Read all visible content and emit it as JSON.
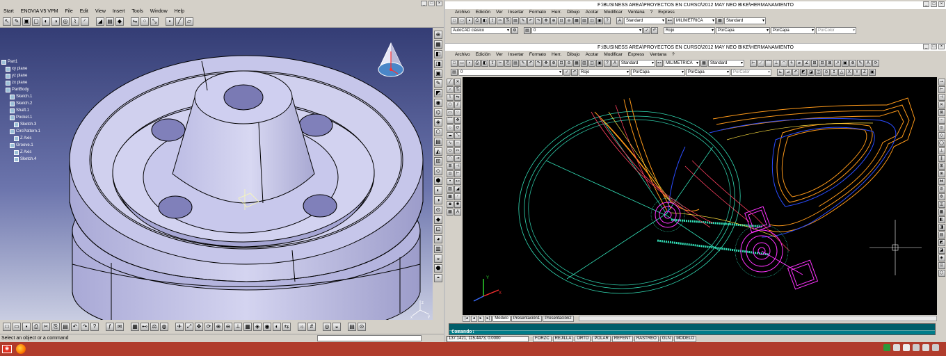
{
  "catia": {
    "menu": [
      "Start",
      "ENOVIA V5 VPM",
      "File",
      "Edit",
      "View",
      "Insert",
      "Tools",
      "Window",
      "Help"
    ],
    "tree": [
      {
        "label": "Part1",
        "level": 0
      },
      {
        "label": "xy plane",
        "level": 1
      },
      {
        "label": "yz plane",
        "level": 1
      },
      {
        "label": "zx plane",
        "level": 1
      },
      {
        "label": "PartBody",
        "level": 1
      },
      {
        "label": "Sketch.1",
        "level": 2
      },
      {
        "label": "Sketch.2",
        "level": 2
      },
      {
        "label": "Shaft.1",
        "level": 2
      },
      {
        "label": "Pocket.1",
        "level": 2
      },
      {
        "label": "Sketch.3",
        "level": 3
      },
      {
        "label": "CircPattern.1",
        "level": 2
      },
      {
        "label": "Z Axis",
        "level": 3
      },
      {
        "label": "Groove.1",
        "level": 2
      },
      {
        "label": "Z Axis",
        "level": 3
      },
      {
        "label": "Sketch.4",
        "level": 3
      }
    ],
    "status_text": "Select an object or a command",
    "compass_label": "",
    "axis_label_x": "x",
    "axis_label_y": "y",
    "axis_label_z": "z"
  },
  "autocad": {
    "outer_title": "F:\\BUSINESS AREA\\PROYECTOS EN CURSO\\2012 MAY NEO BIKE\\HERMANAMIENTO",
    "inner_title": "F:\\BUSINESS AREA\\PROYECTOS EN CURSO\\2012 MAY NEO BIKE\\HERMANAMIENTO",
    "menu": [
      "Archivo",
      "Edición",
      "Ver",
      "Insertar",
      "Formato",
      "Herr.",
      "Dibujo",
      "Acotar",
      "Modificar",
      "Ventana",
      "?",
      "Express"
    ],
    "inner_menu": [
      "Archivo",
      "Edición",
      "Ver",
      "Insertar",
      "Formato",
      "Herr.",
      "Dibujo",
      "Acotar",
      "Modificar",
      "Express",
      "Ventana",
      "?"
    ],
    "workspace": "AutoCAD clásico",
    "layer": "0",
    "color": "Rojo",
    "linetype": "PorCapa",
    "lineweight": "PorCapa",
    "plotstyle": "PorColor",
    "text_style": "Standard",
    "dim_style": "MILIMETRICA",
    "table_style": "Standard",
    "tabs": [
      "Modelo",
      "Presentación1",
      "Presentación2"
    ],
    "command_prompt": "Comando:",
    "coordinates": "137.1421, 115.4473, 0.0000",
    "status_toggles": [
      "FORZC",
      "REJILLA",
      "ORTO",
      "POLAR",
      "REFENT",
      "RASTREO",
      "GLN",
      "MODELO"
    ],
    "ucs_x": "X",
    "ucs_y": "Y"
  },
  "colors": {
    "catia_bg_top": "#343d75",
    "catia_bg_bottom": "#c9cde2",
    "part_fill": "#c8c8ea",
    "acad_bg": "#000000",
    "frame_orange": "#ff9a1a",
    "frame_blue": "#2a4cff",
    "wheel_cyan": "#33e0b8",
    "gear_magenta": "#ff33ff",
    "cmd_bg": "#007d8a",
    "taskbar": "#b03c2c"
  }
}
